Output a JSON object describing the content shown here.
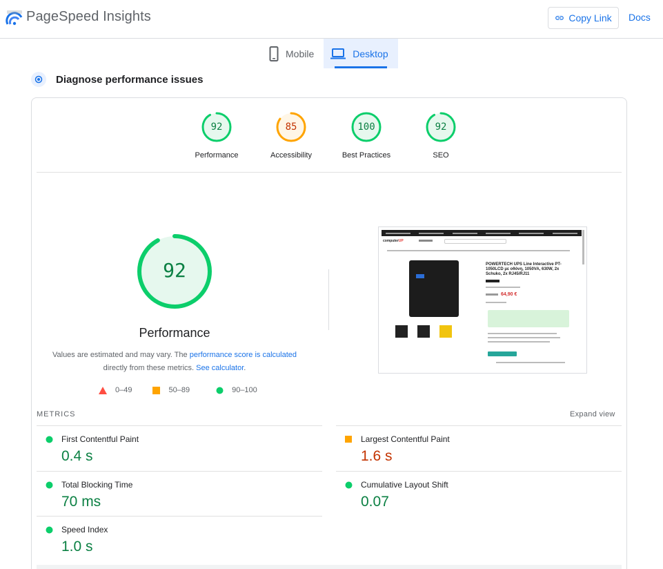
{
  "app": {
    "title": "PageSpeed Insights"
  },
  "header": {
    "copy_link_label": "Copy Link",
    "docs_label": "Docs"
  },
  "tabs": [
    {
      "label": "Mobile",
      "icon": "phone-icon",
      "active": false
    },
    {
      "label": "Desktop",
      "icon": "laptop-icon",
      "active": true
    }
  ],
  "section": {
    "title": "Diagnose performance issues"
  },
  "scores": [
    {
      "label": "Performance",
      "value": "92",
      "score": 0.92,
      "status": "pass",
      "color": "#0cce6b",
      "text_color": "#0b8043",
      "fill": "#e6f8ee"
    },
    {
      "label": "Accessibility",
      "value": "85",
      "score": 0.85,
      "status": "average",
      "color": "#ffa400",
      "text_color": "#c33300",
      "fill": "#fff6e6"
    },
    {
      "label": "Best Practices",
      "value": "100",
      "score": 1.0,
      "status": "pass",
      "color": "#0cce6b",
      "text_color": "#0b8043",
      "fill": "#e6f8ee"
    },
    {
      "label": "SEO",
      "value": "92",
      "score": 0.92,
      "status": "pass",
      "color": "#0cce6b",
      "text_color": "#0b8043",
      "fill": "#e6f8ee"
    }
  ],
  "performance": {
    "score": "92",
    "score_fraction": 0.92,
    "label": "Performance",
    "note_prefix": "Values are estimated and may vary. The ",
    "note_link1": "performance score is calculated",
    "note_middle": " directly from these metrics. ",
    "note_link2": "See calculator",
    "note_suffix": "."
  },
  "legend": [
    {
      "shape": "triangle",
      "color": "#ff4e42",
      "range": "0–49"
    },
    {
      "shape": "square",
      "color": "#ffa400",
      "range": "50–89"
    },
    {
      "shape": "circle",
      "color": "#0cce6b",
      "range": "90–100"
    }
  ],
  "screenshot": {
    "brand": "computer",
    "brand_accent": "UP",
    "product_title": "POWERTECH UPS Line Interactive PT-1050LCD με οθόνη, 1050VA, 630W, 2x Schuko, 2x RJ45/RJ11",
    "price": "64,90 €"
  },
  "metrics_section": {
    "title": "METRICS",
    "expand_label": "Expand view"
  },
  "metrics": [
    {
      "name": "First Contentful Paint",
      "value": "0.4 s",
      "status": "pass"
    },
    {
      "name": "Largest Contentful Paint",
      "value": "1.6 s",
      "status": "average"
    },
    {
      "name": "Total Blocking Time",
      "value": "70 ms",
      "status": "pass"
    },
    {
      "name": "Cumulative Layout Shift",
      "value": "0.07",
      "status": "pass"
    },
    {
      "name": "Speed Index",
      "value": "1.0 s",
      "status": "pass"
    }
  ],
  "colors": {
    "accent": "#1a73e8",
    "pass": "#0cce6b",
    "average": "#ffa400",
    "fail": "#ff4e42"
  }
}
